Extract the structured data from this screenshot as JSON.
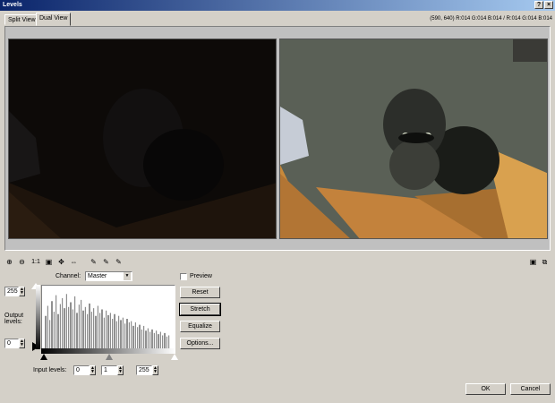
{
  "window": {
    "title": "Levels"
  },
  "titlebar_buttons": [
    "?",
    "×"
  ],
  "tabs": [
    {
      "label": "Split View",
      "active": false
    },
    {
      "label": "Dual View",
      "active": true
    }
  ],
  "readout": "(590, 640) R:014 G:014 B:014 / R:014 G:014 B:014",
  "toolbar": {
    "zoom_in": "⊕",
    "zoom_out": "⊖",
    "actual_size": "1:1",
    "fit": "▣",
    "pan": "✥",
    "eyedropper_black": "✎",
    "eyedropper_gray": "✎",
    "eyedropper_white": "✎",
    "right_icon_1": "▣",
    "right_icon_2": "⧉"
  },
  "controls": {
    "channel_label": "Channel:",
    "channel_value": "Master",
    "preview_label": "Preview",
    "preview_checked": false,
    "output_levels_label_1": "Output",
    "output_levels_label_2": "levels:",
    "output_max": "255",
    "output_min": "0",
    "input_levels_label": "Input levels:",
    "input_black": "0",
    "input_gamma": "1",
    "input_white": "255"
  },
  "buttons": {
    "reset": "Reset",
    "stretch": "Stretch",
    "equalize": "Equalize",
    "options": "Options...",
    "ok": "OK",
    "cancel": "Cancel"
  },
  "histogram_values": [
    0.55,
    0.72,
    0.48,
    0.8,
    0.62,
    0.9,
    0.58,
    0.75,
    0.85,
    0.68,
    0.92,
    0.7,
    0.78,
    0.66,
    0.88,
    0.6,
    0.74,
    0.82,
    0.64,
    0.7,
    0.58,
    0.76,
    0.62,
    0.68,
    0.55,
    0.72,
    0.6,
    0.66,
    0.52,
    0.64,
    0.56,
    0.6,
    0.5,
    0.58,
    0.46,
    0.55,
    0.48,
    0.52,
    0.42,
    0.5,
    0.44,
    0.46,
    0.38,
    0.44,
    0.36,
    0.4,
    0.32,
    0.38,
    0.3,
    0.34,
    0.28,
    0.32,
    0.26,
    0.3,
    0.24,
    0.28,
    0.22,
    0.26,
    0.2,
    0.22
  ]
}
